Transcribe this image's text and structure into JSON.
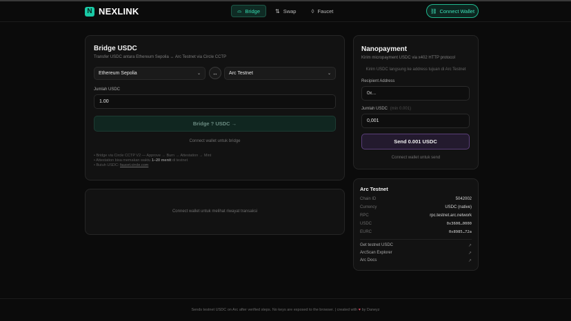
{
  "brand": {
    "logo_letter": "N",
    "name": "NEXLINK",
    "accent": "#19c9a5"
  },
  "nav": {
    "tabs": [
      {
        "label": "Bridge",
        "icon": "bridge-icon",
        "active": true
      },
      {
        "label": "Swap",
        "icon": "swap-arrows-icon",
        "active": false
      },
      {
        "label": "Faucet",
        "icon": "droplet-icon",
        "active": false
      }
    ],
    "connect_label": "Connect Wallet",
    "connect_icon": "link-icon"
  },
  "bridge": {
    "title": "Bridge USDC",
    "subtitle": "Transfer USDC antara Ethereum Sepolia ↔ Arc Testnet via Circle CCTP",
    "from_chain": "Ethereum Sepolia",
    "to_chain": "Arc Testnet",
    "swap_glyph": "↔",
    "amount_label": "Jumlah USDC",
    "amount_value": "1.00",
    "button_label": "Bridge ? USDC →",
    "connect_hint": "Connect wallet untuk bridge",
    "notes": {
      "line1": "• Bridge via Circle CCTP V2 — Approve → Burn → Attestation → Mint",
      "line2_pre": "• Attestation bisa memakan waktu ",
      "line2_bold": "1–20 menit",
      "line2_post": " di testnet",
      "line3_pre": "• Butuh USDC: ",
      "line3_link": "faucet.circle.com"
    }
  },
  "history": {
    "empty_text": "Connect wallet untuk melihat riwayat transaksi"
  },
  "nanopayment": {
    "title": "Nanopayment",
    "subtitle": "Kirim micropayment USDC via x402 HTTP protocol",
    "description": "Kirim USDC langsung ke address tujuan di Arc Testnet",
    "recipient_label": "Recipient Address",
    "recipient_placeholder": "0x...",
    "amount_label": "Jumlah USDC",
    "amount_hint": "(min 0.001)",
    "amount_value": "0,001",
    "button_label": "Send 0.001 USDC",
    "connect_hint": "Connect wallet untuk send"
  },
  "arc_testnet": {
    "title": "Arc Testnet",
    "rows": [
      {
        "key": "Chain ID",
        "value": "5042002"
      },
      {
        "key": "Currency",
        "value": "USDC (native)"
      },
      {
        "key": "RPC",
        "value": "rpc.testnet.arc.network"
      },
      {
        "key": "USDC",
        "value": "0x3600…0000"
      },
      {
        "key": "EURC",
        "value": "0x8985…72a"
      }
    ],
    "links": [
      {
        "label": "Get testnet USDC",
        "arrow": "↗"
      },
      {
        "label": "ArcScan Explorer",
        "arrow": "↗"
      },
      {
        "label": "Arc Docs",
        "arrow": "↗"
      }
    ]
  },
  "footer": {
    "text_pre": "Sends testnet USDC on Arc after verified steps. No keys are exposed to the browser. | created with",
    "heart": "♥",
    "text_post": "by Daneyz"
  }
}
